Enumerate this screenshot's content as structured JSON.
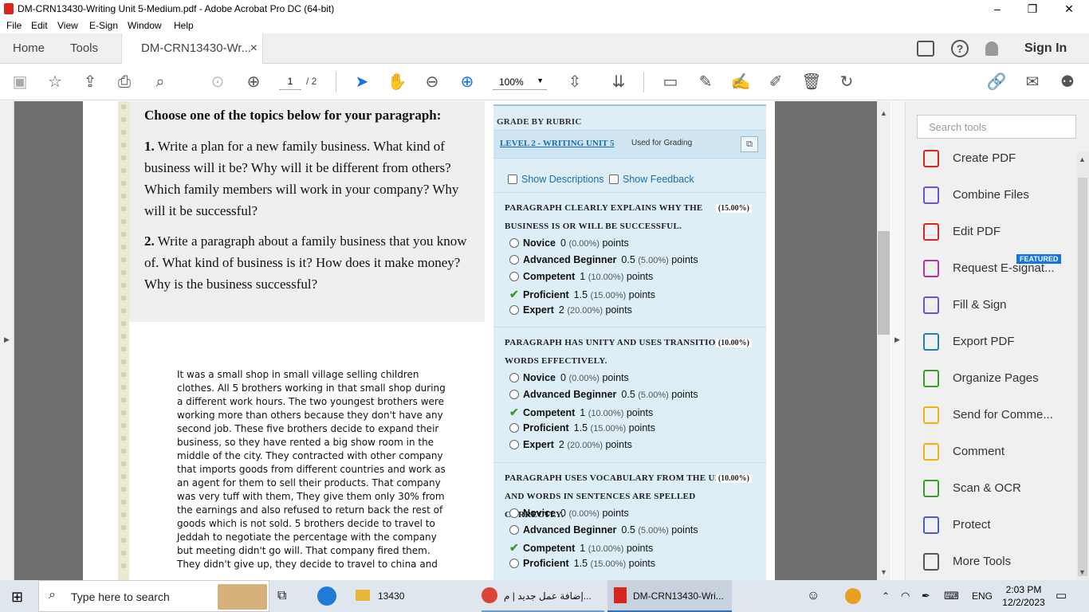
{
  "window": {
    "title": "DM-CRN13430-Writing Unit 5-Medium.pdf - Adobe Acrobat Pro DC (64-bit)",
    "minimize": "–",
    "maximize": "❐",
    "close": "✕"
  },
  "menu": [
    "File",
    "Edit",
    "View",
    "E-Sign",
    "Window",
    "Help"
  ],
  "tabs": {
    "home": "Home",
    "tools": "Tools",
    "doc": "DM-CRN13430-Wr...",
    "doc_close": "×",
    "sign_in": "Sign In"
  },
  "toolbar": {
    "page_current": "1",
    "page_total": "/ 2",
    "zoom": "100%"
  },
  "document": {
    "topic_heading": "Choose one of the topics below for your paragraph:",
    "topic_1_num": "1.",
    "topic_1": "Write a plan for a new family business. What kind of business will it be? Why will it be different from others? Which family members will work in your company? Why will it be successful?",
    "topic_2_num": "2.",
    "topic_2": "Write a paragraph about a family business that you know of. What kind of business is it? How does it make money? Why is the business successful?",
    "essay": "It was a small shop in small village selling children clothes. All 5 brothers working in that small shop during a different work hours. The two youngest brothers were working more than others because they don't have any second job. These five brothers decide to expand their business, so they have rented a big show room in the middle of the city. They contracted with other company that imports goods from different countries and work as an agent for them to sell their products. That company was very tuff with them, They give them only 30% from the earnings and also refused to return back the rest of goods which is not sold. 5 brothers decide to travel to Jeddah to negotiate the percentage with the company but meeting didn't go will. That company fired them. They didn't give up, they decide to travel to china and"
  },
  "rubric": {
    "header": "GRADE BY RUBRIC",
    "name": "LEVEL 2 - WRITING UNIT 5",
    "used_for": "Used for Grading",
    "show_descriptions": "Show Descriptions",
    "show_feedback": "Show Feedback",
    "points_word": "points",
    "criteria": [
      {
        "title": "PARAGRAPH CLEARLY EXPLAINS WHY THE BUSINESS IS OR WILL BE SUCCESSFUL.",
        "weight": "(15.00%)",
        "levels": [
          {
            "name": "Novice",
            "points": "0",
            "pct": "(0.00%)",
            "selected": false
          },
          {
            "name": "Advanced Beginner",
            "points": "0.5",
            "pct": "(5.00%)",
            "selected": false
          },
          {
            "name": "Competent",
            "points": "1",
            "pct": "(10.00%)",
            "selected": false
          },
          {
            "name": "Proficient",
            "points": "1.5",
            "pct": "(15.00%)",
            "selected": true
          },
          {
            "name": "Expert",
            "points": "2",
            "pct": "(20.00%)",
            "selected": false
          }
        ]
      },
      {
        "title": "PARAGRAPH HAS UNITY AND USES TRANSITION WORDS EFFECTIVELY.",
        "weight": "(10.00%)",
        "levels": [
          {
            "name": "Novice",
            "points": "0",
            "pct": "(0.00%)",
            "selected": false
          },
          {
            "name": "Advanced Beginner",
            "points": "0.5",
            "pct": "(5.00%)",
            "selected": false
          },
          {
            "name": "Competent",
            "points": "1",
            "pct": "(10.00%)",
            "selected": true
          },
          {
            "name": "Proficient",
            "points": "1.5",
            "pct": "(15.00%)",
            "selected": false
          },
          {
            "name": "Expert",
            "points": "2",
            "pct": "(20.00%)",
            "selected": false
          }
        ]
      },
      {
        "title": "PARAGRAPH USES VOCABULARY FROM THE UNIT AND WORDS IN SENTENCES ARE SPELLED CORRECTLY.",
        "weight": "(10.00%)",
        "levels": [
          {
            "name": "Novice",
            "points": "0",
            "pct": "(0.00%)",
            "selected": false
          },
          {
            "name": "Advanced Beginner",
            "points": "0.5",
            "pct": "(5.00%)",
            "selected": false
          },
          {
            "name": "Competent",
            "points": "1",
            "pct": "(10.00%)",
            "selected": true
          },
          {
            "name": "Proficient",
            "points": "1.5",
            "pct": "(15.00%)",
            "selected": false
          }
        ]
      }
    ]
  },
  "tools_panel": {
    "search_placeholder": "Search tools",
    "featured": "FEATURED",
    "items": [
      {
        "label": "Create PDF",
        "icon": "create-pdf-icon",
        "color": "#d8261f"
      },
      {
        "label": "Combine Files",
        "icon": "combine-files-icon",
        "color": "#6e4fd6"
      },
      {
        "label": "Edit PDF",
        "icon": "edit-pdf-icon",
        "color": "#d8261f"
      },
      {
        "label": "Request E-signat...",
        "icon": "request-esign-icon",
        "color": "#b5359a"
      },
      {
        "label": "Fill & Sign",
        "icon": "fill-sign-icon",
        "color": "#6e4fd6"
      },
      {
        "label": "Export PDF",
        "icon": "export-pdf-icon",
        "color": "#1f7fb5"
      },
      {
        "label": "Organize Pages",
        "icon": "organize-pages-icon",
        "color": "#3a9a2c"
      },
      {
        "label": "Send for Comme...",
        "icon": "send-comment-icon",
        "color": "#e8b41a"
      },
      {
        "label": "Comment",
        "icon": "comment-icon",
        "color": "#e8b41a"
      },
      {
        "label": "Scan & OCR",
        "icon": "scan-ocr-icon",
        "color": "#3a9a2c"
      },
      {
        "label": "Protect",
        "icon": "protect-icon",
        "color": "#4a5fc1"
      },
      {
        "label": "More Tools",
        "icon": "more-tools-icon",
        "color": "#555555"
      }
    ]
  },
  "taskbar": {
    "search": "Type here to search",
    "folder": "13430",
    "chrome_tab": "إضافة عمل جديد | م...",
    "acrobat": "DM-CRN13430-Wri...",
    "lang": "ENG",
    "time": "2:03 PM",
    "date": "12/2/2023"
  }
}
